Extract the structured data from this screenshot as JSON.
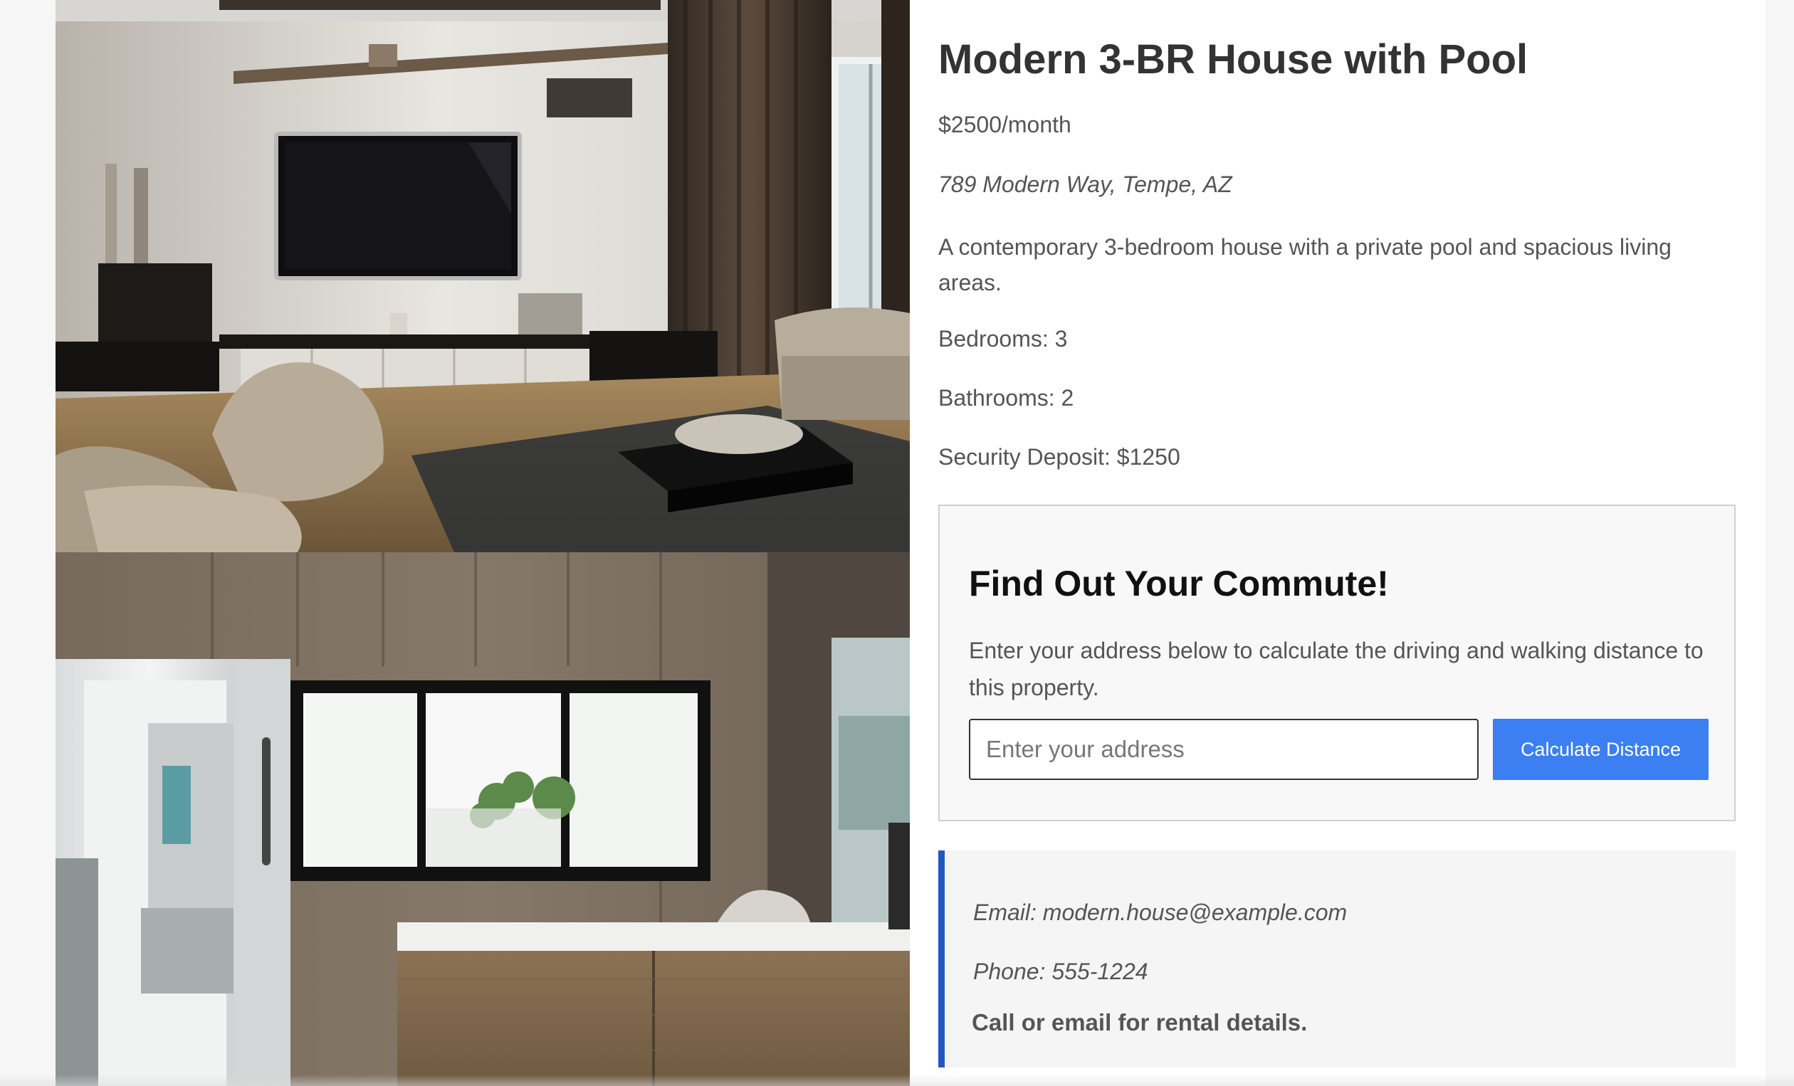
{
  "listing": {
    "title": "Modern 3-BR House with Pool",
    "price": "$2500/month",
    "address": "789 Modern Way, Tempe, AZ",
    "description": "A contemporary 3-bedroom house with a private pool and spacious living areas.",
    "bedrooms": "Bedrooms: 3",
    "bathrooms": "Bathrooms: 2",
    "security_deposit": "Security Deposit: $1250"
  },
  "commute": {
    "title": "Find Out Your Commute!",
    "description": "Enter your address below to calculate the driving and walking distance to this property.",
    "address_placeholder": "Enter your address",
    "address_value": "",
    "button_label": "Calculate Distance"
  },
  "contact": {
    "email": "Email: modern.house@example.com",
    "phone": "Phone: 555-1224",
    "note": "Call or email for rental details."
  },
  "theme": {
    "button_color": "#3b7ff2",
    "contact_accent": "#2457c5"
  },
  "gallery": {
    "images": [
      "living-room-photo",
      "kitchen-photo"
    ]
  }
}
